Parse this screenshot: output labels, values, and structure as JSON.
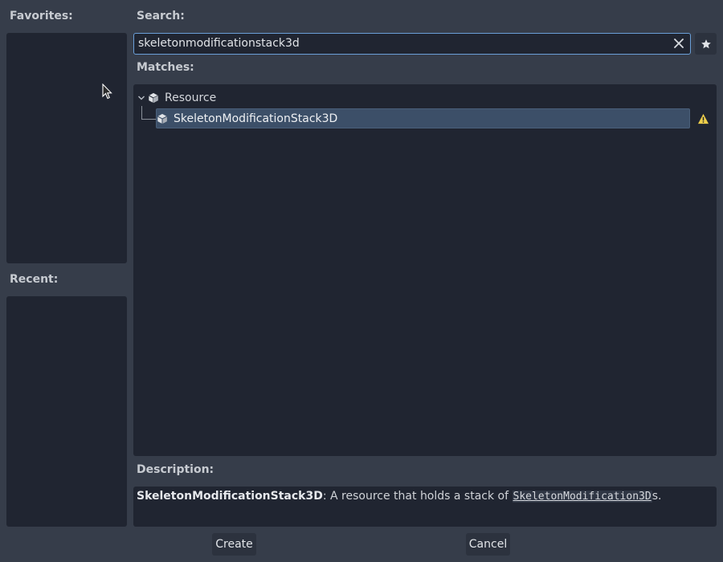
{
  "favorites": {
    "label": "Favorites:"
  },
  "recent": {
    "label": "Recent:"
  },
  "search": {
    "label": "Search:",
    "value": "skeletonmodificationstack3d"
  },
  "matches": {
    "label": "Matches:",
    "tree": {
      "root": {
        "label": "Resource",
        "icon": "resource-cube-icon"
      },
      "child": {
        "label": "SkeletonModificationStack3D",
        "icon": "resource-cube-icon",
        "badge_icon": "warning-icon"
      }
    }
  },
  "description": {
    "label": "Description:",
    "class_name": "SkeletonModificationStack3D",
    "text_before": ": A resource that holds a stack of ",
    "code": "SkeletonModification3D",
    "text_after": "s."
  },
  "buttons": {
    "create": "Create",
    "cancel": "Cancel"
  },
  "colors": {
    "accent": "#6a9fd8",
    "selection": "#3c4f68",
    "warning": "#f0d04a"
  }
}
